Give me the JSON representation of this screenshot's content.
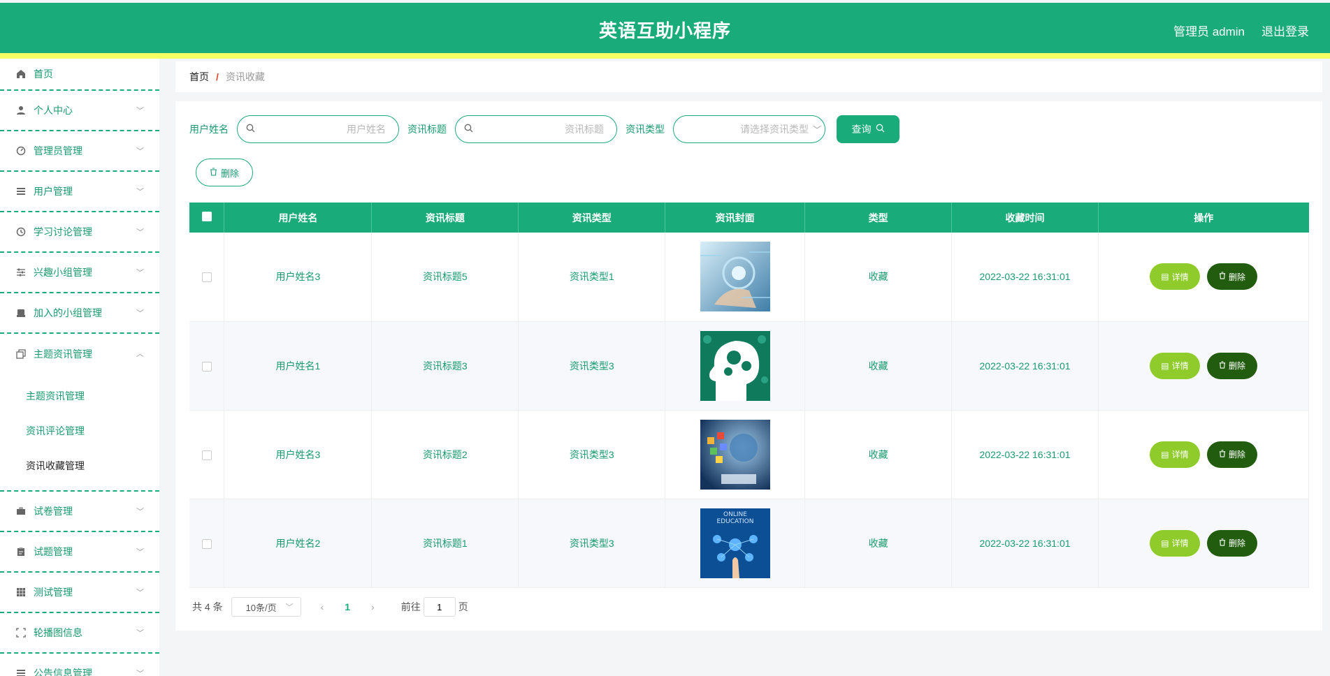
{
  "header": {
    "title": "英语互助小程序",
    "user_label": "管理员 admin",
    "logout_label": "退出登录"
  },
  "sidebar": {
    "items": [
      {
        "label": "首页",
        "icon": "home-icon"
      },
      {
        "label": "个人中心",
        "icon": "user-icon"
      },
      {
        "label": "管理员管理",
        "icon": "gauge-icon"
      },
      {
        "label": "用户管理",
        "icon": "list-icon"
      },
      {
        "label": "学习讨论管理",
        "icon": "clock-icon"
      },
      {
        "label": "兴趣小组管理",
        "icon": "sliders-icon"
      },
      {
        "label": "加入的小组管理",
        "icon": "printer-icon"
      },
      {
        "label": "主题资讯管理",
        "icon": "copy-icon"
      },
      {
        "label": "试卷管理",
        "icon": "briefcase-icon"
      },
      {
        "label": "试题管理",
        "icon": "clipboard-icon"
      },
      {
        "label": "测试管理",
        "icon": "grid-icon"
      },
      {
        "label": "轮播图信息",
        "icon": "fullscreen-icon"
      },
      {
        "label": "公告信息管理",
        "icon": "list-icon"
      }
    ],
    "submenu": [
      "主题资讯管理",
      "资讯评论管理",
      "资讯收藏管理"
    ]
  },
  "breadcrumb": {
    "home": "首页",
    "separator": "/",
    "current": "资讯收藏"
  },
  "search": {
    "username_label": "用户姓名",
    "username_placeholder": "用户姓名",
    "title_label": "资讯标题",
    "title_placeholder": "资讯标题",
    "type_label": "资讯类型",
    "type_placeholder": "请选择资讯类型",
    "query_label": "查询"
  },
  "toolbar": {
    "delete_label": "删除"
  },
  "table": {
    "headers": [
      "用户姓名",
      "资讯标题",
      "资讯类型",
      "资讯封面",
      "类型",
      "收藏时间",
      "操作"
    ],
    "rows": [
      {
        "username": "用户姓名3",
        "title": "资讯标题5",
        "type": "资讯类型1",
        "kind": "收藏",
        "time": "2022-03-22 16:31:01"
      },
      {
        "username": "用户姓名1",
        "title": "资讯标题3",
        "type": "资讯类型3",
        "kind": "收藏",
        "time": "2022-03-22 16:31:01"
      },
      {
        "username": "用户姓名3",
        "title": "资讯标题2",
        "type": "资讯类型3",
        "kind": "收藏",
        "time": "2022-03-22 16:31:01"
      },
      {
        "username": "用户姓名2",
        "title": "资讯标题1",
        "type": "资讯类型3",
        "kind": "收藏",
        "time": "2022-03-22 16:31:01",
        "cover_text_1": "ONLINE",
        "cover_text_2": "EDUCATION"
      }
    ],
    "detail_label": "详情",
    "delete_label": "删除"
  },
  "pagination": {
    "total": "共 4 条",
    "page_size": "10条/页",
    "current_page": "1",
    "goto_label": "前往",
    "goto_value": "1",
    "page_suffix": "页"
  },
  "colors": {
    "primary": "#1aab7a",
    "strip": "#f4ff63",
    "detail": "#8fcc2b",
    "delete": "#225c0e"
  }
}
